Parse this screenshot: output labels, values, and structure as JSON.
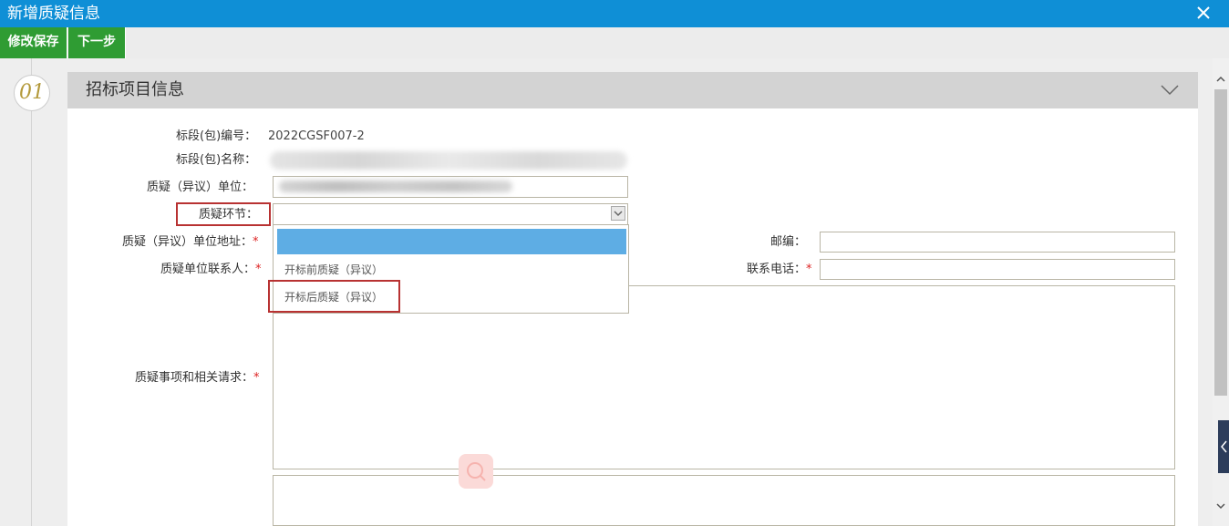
{
  "window": {
    "title": "新增质疑信息",
    "close_icon": "close-icon"
  },
  "toolbar": {
    "save_label": "修改保存",
    "next_label": "下一步"
  },
  "step": {
    "number": "01"
  },
  "panel": {
    "title": "招标项目信息"
  },
  "form": {
    "bid_code_label": "标段(包)编号：",
    "bid_code_value": "2022CGSF007-2",
    "bid_name_label": "标段(包)名称：",
    "unit_label": "质疑（异议）单位：",
    "stage_label": "质疑环节：",
    "address_label": "质疑（异议）单位地址：",
    "postcode_label": "邮编：",
    "contact_label": "质疑单位联系人：",
    "phone_label": "联系电话：",
    "matter_label": "质疑事项和相关请求：",
    "required_mark": "*"
  },
  "dropdown": {
    "options": [
      "",
      "开标前质疑（异议）",
      "开标后质疑（异议）"
    ],
    "highlight_color": "#5eade4"
  },
  "colors": {
    "titlebar": "#0f8fd6",
    "button": "#2f9c33",
    "highlight_box": "#b83232"
  }
}
